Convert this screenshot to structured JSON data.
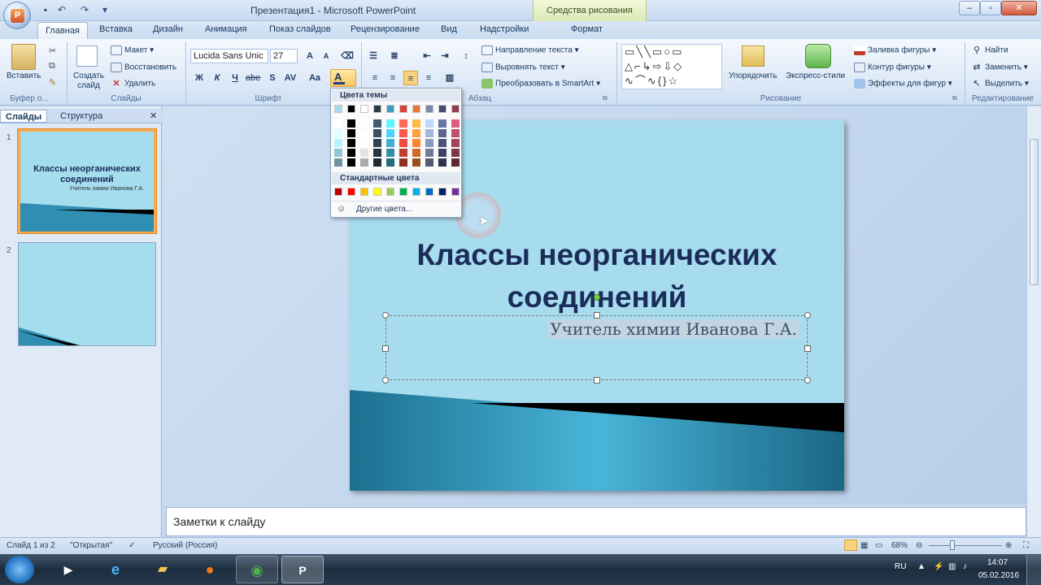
{
  "window": {
    "title": "Презентация1 - Microsoft PowerPoint",
    "context_group": "Средства рисования"
  },
  "tabs": [
    "Главная",
    "Вставка",
    "Дизайн",
    "Анимация",
    "Показ слайдов",
    "Рецензирование",
    "Вид",
    "Надстройки",
    "Формат"
  ],
  "ribbon": {
    "clipboard": {
      "paste": "Вставить",
      "label": "Буфер о..."
    },
    "slides": {
      "new_slide": "Создать слайд",
      "layout": "Макет",
      "reset": "Восстановить",
      "delete": "Удалить",
      "label": "Слайды"
    },
    "font": {
      "font_name": "Lucida Sans Unic",
      "font_size": "27",
      "label": "Шрифт",
      "bold": "Ж",
      "italic": "К",
      "underline": "Ч",
      "strike": "abe",
      "shadow": "S",
      "spacing": "AV",
      "case": "Aa",
      "color_letter": "A"
    },
    "paragraph": {
      "text_direction": "Направление текста",
      "align_text": "Выровнять текст",
      "smartart": "Преобразовать в SmartArt",
      "label": "Абзац"
    },
    "drawing": {
      "arrange": "Упорядочить",
      "quick_styles": "Экспресс-стили",
      "fill": "Заливка фигуры",
      "outline": "Контур фигуры",
      "effects": "Эффекты для фигур",
      "label": "Рисование"
    },
    "editing": {
      "find": "Найти",
      "replace": "Заменить",
      "select": "Выделить",
      "label": "Редактирование"
    }
  },
  "color_popup": {
    "theme_header": "Цвета темы",
    "standard_header": "Стандартные цвета",
    "more_colors": "Другие цвета...",
    "theme_top": [
      "#a6dced",
      "#000000",
      "#ffffff",
      "#2b3b47",
      "#3b9fbd",
      "#d9433a",
      "#e8782d",
      "#7b8aa8",
      "#444b6e",
      "#8e3d52"
    ],
    "standard": [
      "#c00000",
      "#ff0000",
      "#ffc000",
      "#ffff00",
      "#92d050",
      "#00b050",
      "#00b0f0",
      "#0070c0",
      "#002060",
      "#7030a0"
    ]
  },
  "panel_tabs": {
    "slides": "Слайды",
    "outline": "Структура"
  },
  "thumbnails": [
    {
      "num": "1",
      "title": "Классы неорганических соединений",
      "subtitle": "Учитель химии Иванова Г.А."
    },
    {
      "num": "2"
    }
  ],
  "slide": {
    "title_line1": "Классы неорганических",
    "title_line2": "соединений",
    "subtitle": "Учитель химии Иванова Г.А."
  },
  "notes": "Заметки к слайду",
  "status": {
    "slide": "Слайд 1 из 2",
    "theme": "\"Открытая\"",
    "lang": "Русский (Россия)",
    "zoom": "68%"
  },
  "tray": {
    "lang": "RU",
    "time": "14:07",
    "date": "05.02.2016"
  }
}
